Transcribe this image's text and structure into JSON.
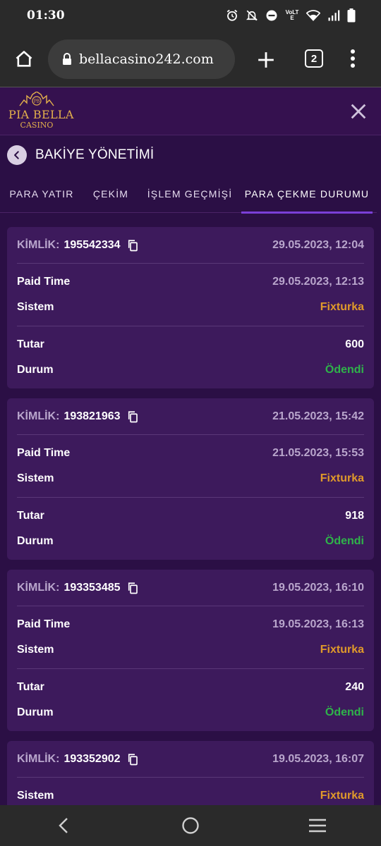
{
  "status_bar": {
    "time": "01:30",
    "network_label": "VoLTE"
  },
  "browser": {
    "url": "bellacasino242.com",
    "tab_count": "2"
  },
  "site": {
    "logo_main": "PIA BELLA",
    "logo_sub": "CASINO",
    "logo_monogram": "PB"
  },
  "page": {
    "title": "BAKİYE YÖNETİMİ"
  },
  "tabs": [
    {
      "label": "PARA YATIR",
      "active": false
    },
    {
      "label": "ÇEKİM",
      "active": false
    },
    {
      "label": "İŞLEM GEÇMİŞİ",
      "active": false
    },
    {
      "label": "PARA ÇEKME DURUMU",
      "active": true
    }
  ],
  "labels": {
    "id": "KİMLİK:",
    "paid_time": "Paid Time",
    "system": "Sistem",
    "amount": "Tutar",
    "status": "Durum"
  },
  "cards": [
    {
      "id": "195542334",
      "date": "29.05.2023, 12:04",
      "paid_time": "29.05.2023, 12:13",
      "system": "Fixturka",
      "amount": "600",
      "status": "Ödendi"
    },
    {
      "id": "193821963",
      "date": "21.05.2023, 15:42",
      "paid_time": "21.05.2023, 15:53",
      "system": "Fixturka",
      "amount": "918",
      "status": "Ödendi"
    },
    {
      "id": "193353485",
      "date": "19.05.2023, 16:10",
      "paid_time": "19.05.2023, 16:13",
      "system": "Fixturka",
      "amount": "240",
      "status": "Ödendi"
    },
    {
      "id": "193352902",
      "date": "19.05.2023, 16:07",
      "system": "Fixturka"
    }
  ],
  "colors": {
    "background": "#2b0f45",
    "card": "#3d1a5c",
    "system_value": "#e09a2a",
    "status_paid": "#2fb34a",
    "active_tab": "#7b3fd8",
    "logo_gold": "#e3b04b"
  }
}
